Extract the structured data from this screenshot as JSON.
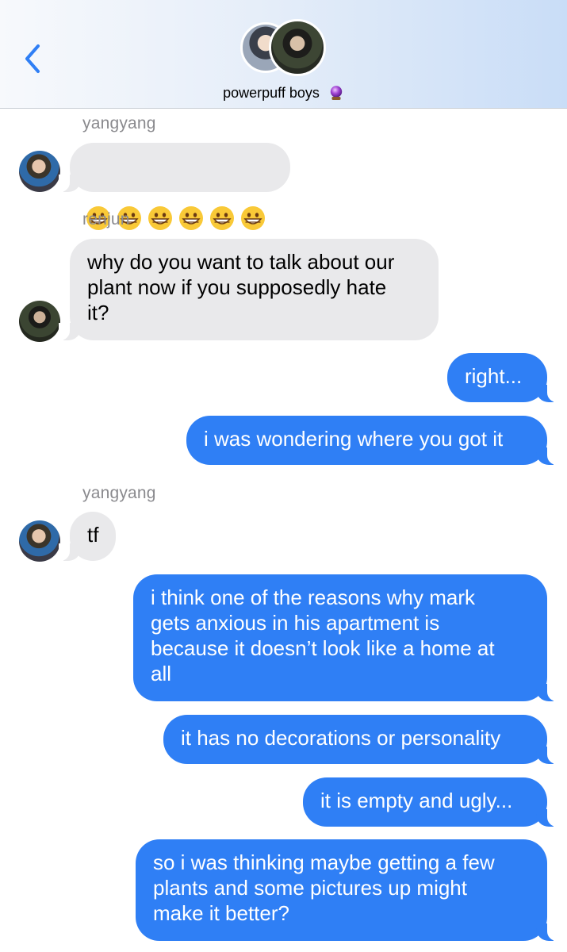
{
  "header": {
    "title": "powerpuff boys",
    "back_icon": "chevron-left-icon",
    "title_emoji": "crystal-ball-icon",
    "accent": "#2f7ff5"
  },
  "messages": [
    {
      "sender": "yangyang",
      "direction": "incoming",
      "emoji": [
        "grinning-face-icon",
        "grinning-face-icon",
        "grinning-face-icon",
        "grinning-face-icon",
        "grinning-face-icon",
        "grinning-face-icon"
      ]
    },
    {
      "sender": "renjun",
      "direction": "incoming",
      "text": "why do you want to talk about our\nplant now if you supposedly hate\nit?"
    },
    {
      "direction": "outgoing",
      "text": "right..."
    },
    {
      "direction": "outgoing",
      "text": "i was wondering where you got it"
    },
    {
      "sender": "yangyang",
      "direction": "incoming",
      "text": "tf"
    },
    {
      "direction": "outgoing",
      "text": "i think one of the reasons why mark\ngets anxious in his apartment is\nbecause it doesn’t look like a home at\nall"
    },
    {
      "direction": "outgoing",
      "text": "it has no decorations or personality"
    },
    {
      "direction": "outgoing",
      "text": "it is empty and ugly..."
    },
    {
      "direction": "outgoing",
      "text": "so i was thinking maybe getting a few\nplants and some pictures up might\nmake it better?"
    }
  ]
}
